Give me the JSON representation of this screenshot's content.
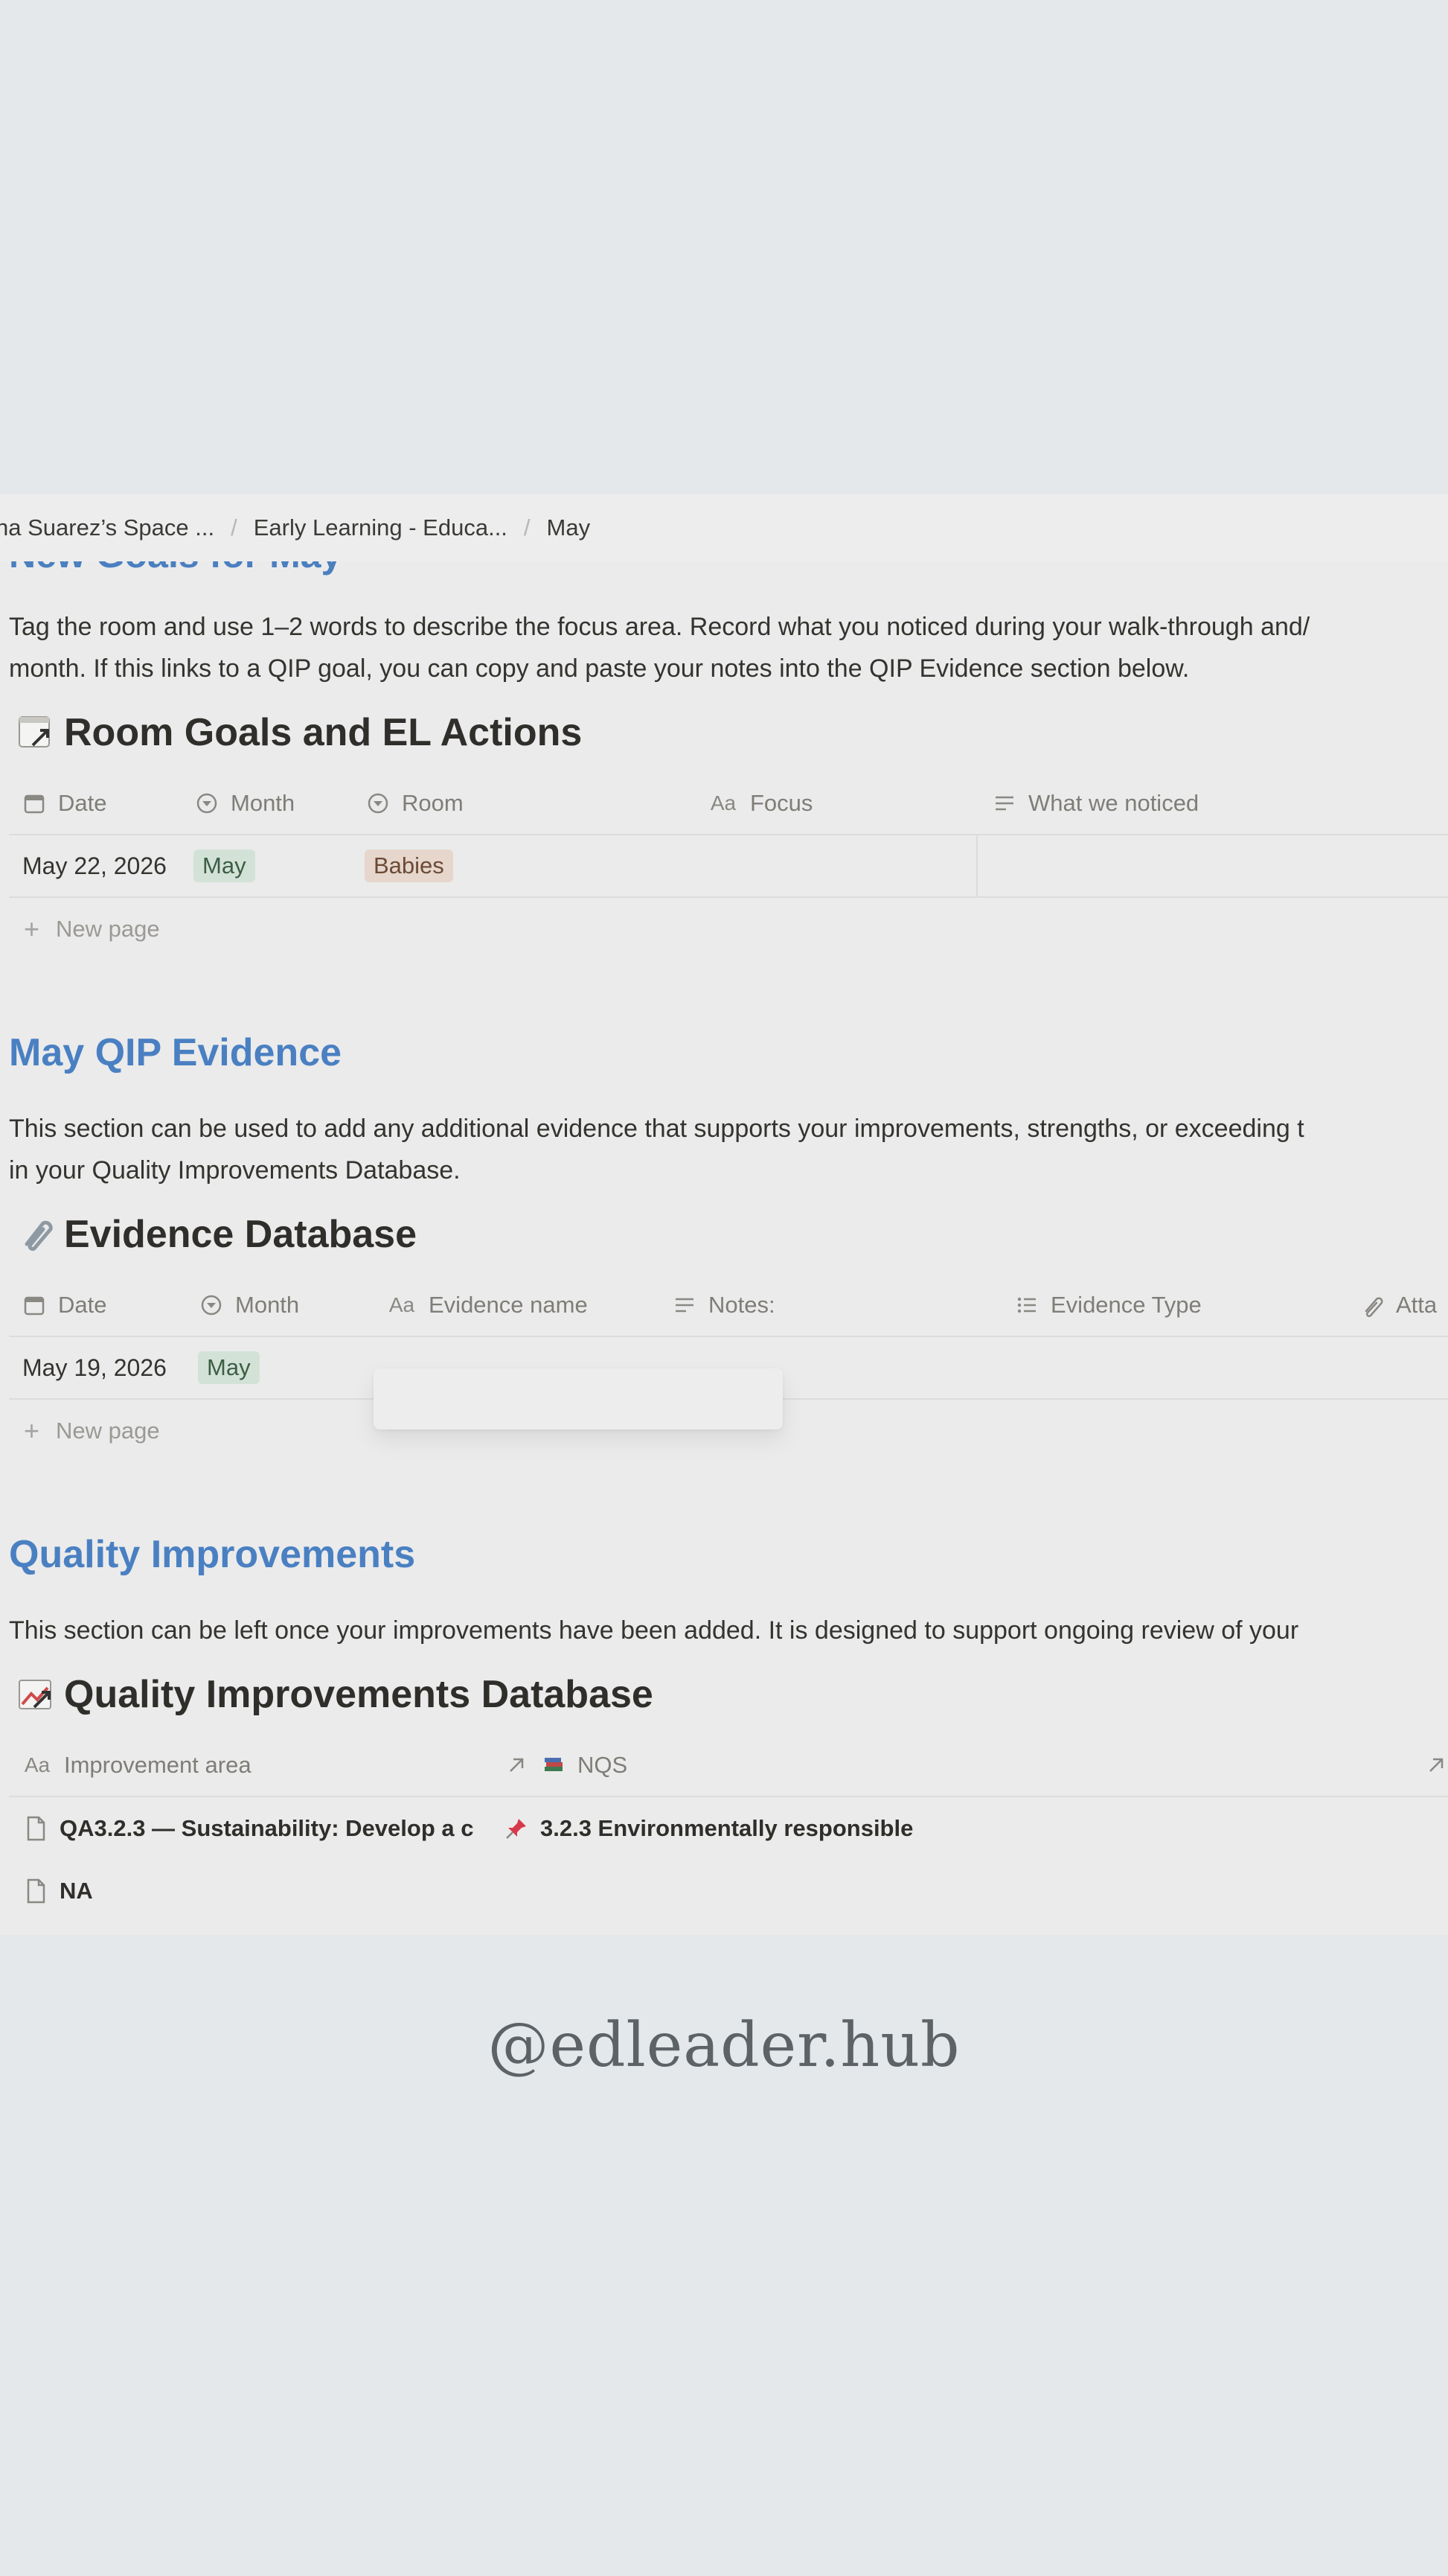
{
  "breadcrumb": {
    "workspace": "na Suarez’s Space ...",
    "parent": "Early Learning - Educa...",
    "current": "May",
    "separator": "/"
  },
  "hidden_heading": "New Goals for May",
  "goals_section": {
    "text_line1": "Tag the room and use 1–2 words to describe the focus area. Record what you noticed during your walk-through and/",
    "text_line2": "month. If this links to a QIP goal, you can copy and paste your notes into the QIP Evidence section below.",
    "db_title": "Room Goals and EL Actions",
    "columns": [
      "Date",
      "Month",
      "Room",
      "Focus",
      "What we noticed"
    ],
    "rows": [
      {
        "date": "May 22, 2026",
        "month": "May",
        "room": "Babies",
        "focus": "",
        "noticed": ""
      }
    ],
    "new_page": "New page"
  },
  "evidence_section": {
    "heading": "May QIP Evidence",
    "text_line1": "This section can be used to add any additional evidence that supports your improvements, strengths, or exceeding t",
    "text_line2": "in your Quality Improvements Database.",
    "db_title": "Evidence Database",
    "columns": [
      "Date",
      "Month",
      "Evidence name",
      "Notes:",
      "Evidence Type",
      "Atta"
    ],
    "rows": [
      {
        "date": "May 19, 2026",
        "month": "May"
      }
    ],
    "new_page": "New page"
  },
  "quality_section": {
    "heading": "Quality Improvements",
    "text_line1": "This section can be left once your improvements have been added. It is designed to support ongoing review of your",
    "db_title": "Quality Improvements Database",
    "columns": [
      "Improvement area",
      "NQS"
    ],
    "rows": [
      {
        "area": "QA3.2.3 — Sustainability: Develop a c",
        "nqs": "3.2.3 Environmentally responsible"
      },
      {
        "area": "NA",
        "nqs": ""
      }
    ]
  },
  "watermark": "@edleader.hub",
  "colors": {
    "heading_blue": "#4a80c2",
    "tag_green_bg": "#d3e2d7",
    "tag_brown_bg": "#e6d6cc",
    "page_bg": "#e4e8ea",
    "panel_bg": "#ebebeb"
  },
  "icons": {
    "date": "calendar-icon",
    "month": "select-icon",
    "room": "select-icon",
    "focus": "title-aa-icon",
    "noticed": "text-lines-icon",
    "evidence_type": "list-icon",
    "attachment": "paperclip-icon",
    "relation": "arrow-up-right-icon",
    "page": "page-icon"
  }
}
